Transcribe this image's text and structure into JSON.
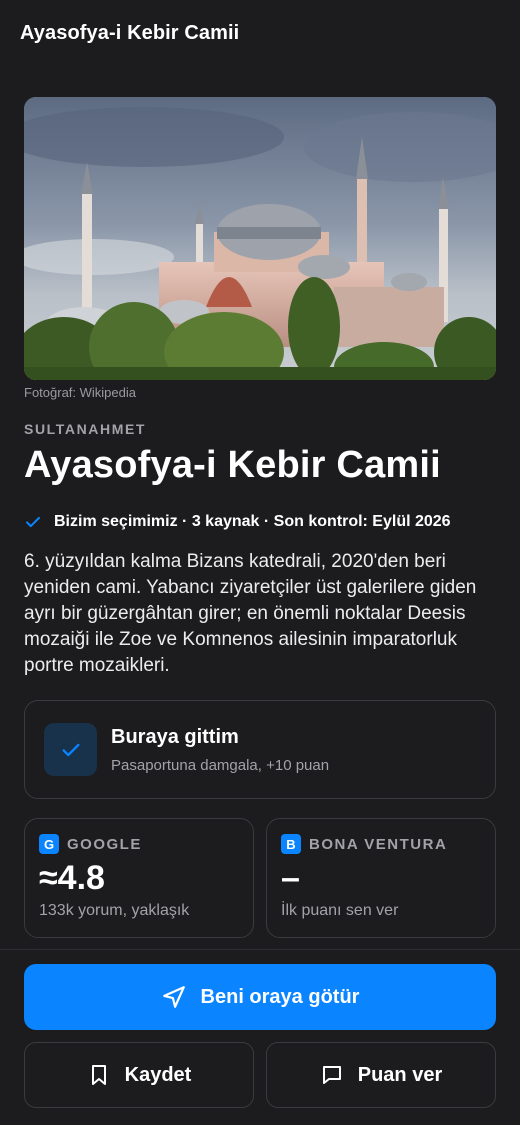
{
  "header": {
    "title": "Ayasofya-i Kebir Camii"
  },
  "hero": {
    "image_alt": "Ayasofya photo",
    "credit": "Fotoğraf: Wikipedia"
  },
  "place": {
    "district": "SULTANAHMET",
    "name": "Ayasofya-i Kebir Camii",
    "meta": "Bizim seçimimiz · 3 kaynak · Son kontrol: Eylül 2026",
    "description": "6. yüzyıldan kalma Bizans katedrali, 2020'den beri yeniden cami. Yabancı ziyaretçiler üst galerilere giden ayrı bir güzergâhtan girer; en önemli noktalar Deesis mozaiği ile Zoe ve Komnenos ailesinin imparatorluk portre mozaikleri."
  },
  "visited": {
    "title": "Buraya gittim",
    "subtitle": "Pasaportuna damgala, +10 puan"
  },
  "ratings": [
    {
      "badge": "G",
      "source": "GOOGLE",
      "value": "≈4.8",
      "sub": "133k yorum, yaklaşık"
    },
    {
      "badge": "B",
      "source": "BONA VENTURA",
      "value": "–",
      "sub": "İlk puanı sen ver"
    }
  ],
  "actions": {
    "navigate_label": "Beni oraya götür",
    "save_label": "Kaydet",
    "rate_label": "Puan ver"
  },
  "colors": {
    "accent": "#0a84ff",
    "background": "#1c1c1e",
    "card_border": "#3a3a3f"
  },
  "icons": {
    "meta": "check-icon",
    "visited": "check-icon",
    "navigate": "navigation-arrow-icon",
    "save": "bookmark-icon",
    "rate": "comment-icon"
  }
}
